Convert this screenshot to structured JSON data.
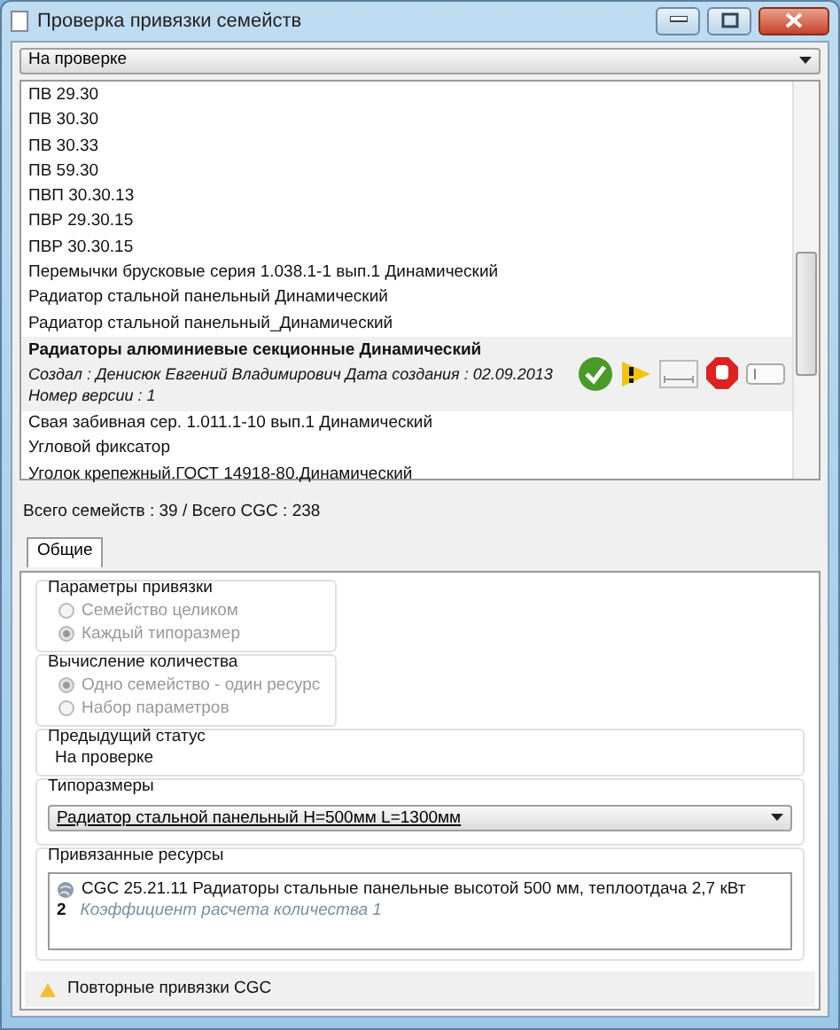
{
  "window": {
    "title": "Проверка привязки семейств"
  },
  "status_filter": {
    "value": "На проверке"
  },
  "families": [
    {
      "name": "ПВ 29.30",
      "selected": false
    },
    {
      "name": "ПВ 30.30",
      "selected": false
    },
    {
      "name": "ПВ 30.33",
      "selected": false
    },
    {
      "name": "ПВ 59.30",
      "selected": false
    },
    {
      "name": "ПВП 30.30.13",
      "selected": false
    },
    {
      "name": "ПВР 29.30.15",
      "selected": false
    },
    {
      "name": "ПВР 30.30.15",
      "selected": false
    },
    {
      "name": "Перемычки брусковые серия 1.038.1-1 вып.1 Динамический",
      "selected": false
    },
    {
      "name": "Радиатор стальной панельный Динамический",
      "selected": false
    },
    {
      "name": "Радиатор стальной панельный_Динамический",
      "selected": false
    },
    {
      "name": "Радиаторы алюминиевые секционные Динамический",
      "selected": true,
      "details": [
        "Создал :  Денисюк Евгений Владимирович  Дата создания :  02.09.2013",
        "Номер версии :  1"
      ]
    },
    {
      "name": "Свая забивная сер. 1.011.1-10 вып.1 Динамический",
      "selected": false
    },
    {
      "name": "Угловой фиксатор",
      "selected": false
    },
    {
      "name": "Уголок крепежный.ГОСТ 14918-80.Динамический",
      "selected": false
    }
  ],
  "totals": "Всего семейств  :  39   /   Всего CGC  :  238",
  "tabs": [
    {
      "label": "Общие",
      "selected": true
    }
  ],
  "binding_params": {
    "title": "Параметры привязки",
    "options": [
      {
        "label": "Семейство целиком",
        "selected": false,
        "disabled": true
      },
      {
        "label": "Каждый типоразмер",
        "selected": true,
        "disabled": true
      }
    ]
  },
  "quantity_calc": {
    "title": "Вычисление количества",
    "options": [
      {
        "label": "Одно семейство - один ресурс",
        "selected": true,
        "disabled": true
      },
      {
        "label": "Набор параметров",
        "selected": false,
        "disabled": true
      }
    ]
  },
  "previous_status": {
    "title": "Предыдущий статус",
    "value": "На проверке"
  },
  "sizes": {
    "title": "Типоразмеры",
    "value": "Радиатор стальной панельный H=500мм L=1300мм"
  },
  "resources": {
    "title": "Привязанные ресурсы",
    "items": [
      {
        "name": "CGC 25.21.11 Радиаторы стальные панельные высотой 500 мм, теплоотдача 2,7 кВт",
        "marker": "2",
        "coefficient": "Коэффициент расчета количества 1"
      }
    ]
  },
  "warning": "Повторные привязки CGC"
}
